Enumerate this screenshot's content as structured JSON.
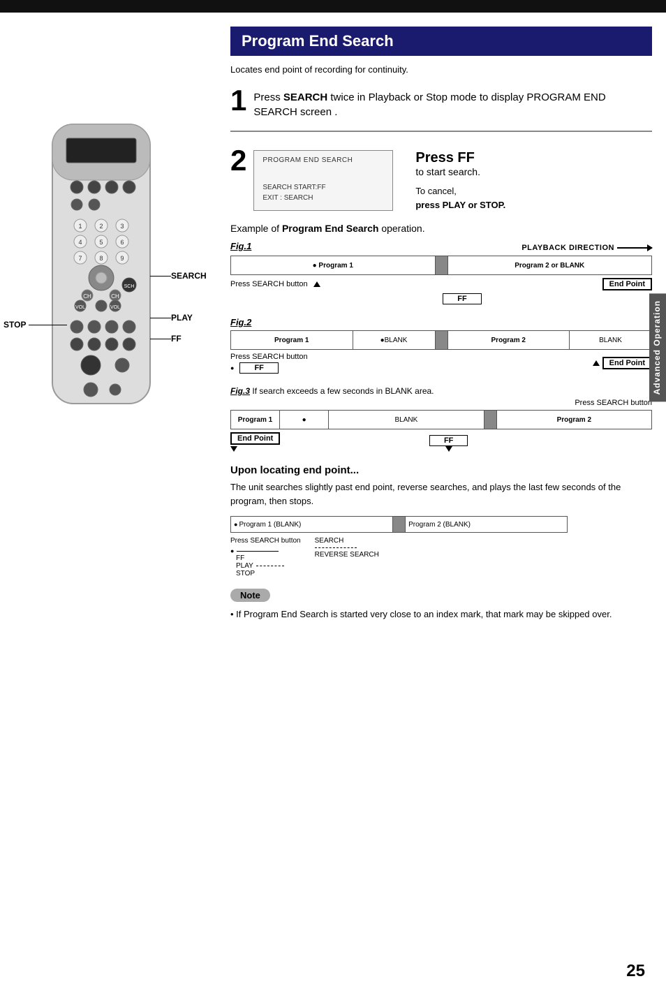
{
  "page": {
    "top_bar": "",
    "page_number": "25",
    "side_tab": "Advanced Operation"
  },
  "section": {
    "title": "Program End Search",
    "subtitle": "Locates end point of recording for continuity.",
    "step1": {
      "number": "1",
      "text_prefix": "Press ",
      "text_bold": "SEARCH",
      "text_suffix": " twice in Playback or Stop mode to display PROGRAM END SEARCH screen ."
    },
    "step2": {
      "number": "2",
      "screen": {
        "title": "PROGRAM END SEARCH",
        "row1": "SEARCH START:FF",
        "row2": "EXIT : SEARCH"
      },
      "press_ff_label": "Press FF",
      "press_ff_sub": "to start search.",
      "to_cancel_label": "To cancel,",
      "to_cancel_bold": "press PLAY or STOP."
    },
    "example": {
      "prefix": "Example of ",
      "bold": "Program End Search",
      "suffix": " operation.",
      "fig1": {
        "label": "Fig.1",
        "direction_label": "PLAYBACK DIRECTION",
        "tape": [
          {
            "text": "Program 1",
            "type": "prog1"
          },
          {
            "text": "",
            "type": "index"
          },
          {
            "text": "Program 2 or BLANK",
            "type": "prog2 no-border"
          }
        ],
        "caption1": "Press SEARCH button",
        "caption2": "FF",
        "end_point": "End Point"
      },
      "fig2": {
        "label": "Fig.2",
        "tape": [
          {
            "text": "Program 1",
            "type": "prog1"
          },
          {
            "text": "●BLANK",
            "type": "blank"
          },
          {
            "text": "",
            "type": "index"
          },
          {
            "text": "Program 2",
            "type": "prog1"
          },
          {
            "text": "BLANK",
            "type": "blank no-border"
          }
        ],
        "caption1": "Press SEARCH button",
        "caption2": "FF",
        "end_point": "End Point"
      },
      "fig3": {
        "label": "Fig.3",
        "description": "If search exceeds a few seconds in BLANK area.",
        "sub_caption": "Press SEARCH button",
        "tape": [
          {
            "text": "Program 1",
            "type": "prog1"
          },
          {
            "text": "●",
            "type": "blank"
          },
          {
            "text": "BLANK",
            "type": "blank"
          },
          {
            "text": "",
            "type": "index"
          },
          {
            "text": "Program 2",
            "type": "prog2 no-border"
          }
        ],
        "ff_label": "FF",
        "end_point": "End Point"
      }
    },
    "upon": {
      "title": "Upon locating end point...",
      "text": "The unit searches slightly past end point, reverse searches, and plays the last few seconds of the program, then stops.",
      "final_tape": {
        "seg1": "Program 1 (BLANK)",
        "seg2": "Program 2 (BLANK)"
      },
      "labels": {
        "press_search": "Press SEARCH button",
        "search_label": "SEARCH",
        "ff_label": "FF",
        "play_label": "PLAY",
        "stop_label": "STOP",
        "reverse_search": "REVERSE SEARCH"
      }
    },
    "note": {
      "label": "Note",
      "text": "• If Program End Search is started very close to an index mark, that mark may be skipped over."
    }
  },
  "remote": {
    "labels": {
      "search": "SEARCH",
      "play": "PLAY",
      "ff": "FF",
      "stop": "STOP"
    }
  }
}
